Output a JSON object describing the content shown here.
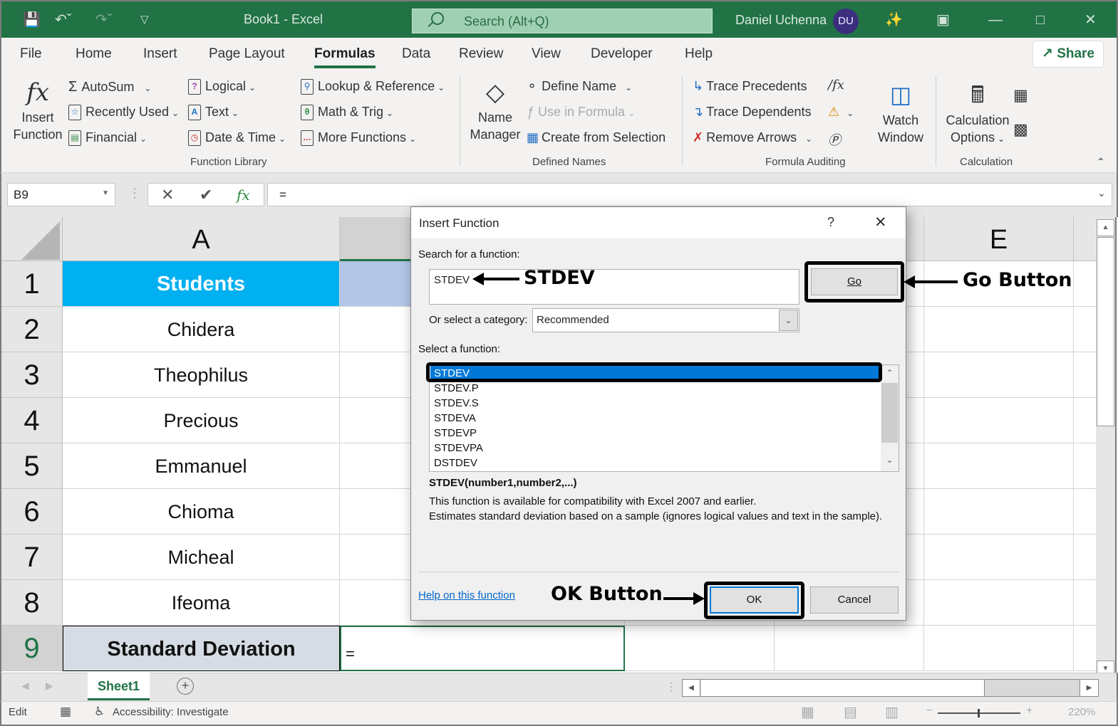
{
  "titlebar": {
    "title": "Book1  -  Excel",
    "search_placeholder": "Search (Alt+Q)",
    "user_name": "Daniel Uchenna",
    "user_initials": "DU"
  },
  "ribbon_tabs": [
    {
      "label": "File"
    },
    {
      "label": "Home"
    },
    {
      "label": "Insert"
    },
    {
      "label": "Page Layout"
    },
    {
      "label": "Formulas",
      "active": true
    },
    {
      "label": "Data"
    },
    {
      "label": "Review"
    },
    {
      "label": "View"
    },
    {
      "label": "Developer"
    },
    {
      "label": "Help"
    }
  ],
  "share_label": "Share",
  "ribbon": {
    "function_library": {
      "group_label": "Function Library",
      "insert_function": [
        "Insert",
        "Function"
      ],
      "autosum": "AutoSum",
      "recently_used": "Recently Used",
      "financial": "Financial",
      "logical": "Logical",
      "text": "Text",
      "date_time": "Date & Time",
      "lookup_reference": "Lookup & Reference",
      "math_trig": "Math & Trig",
      "more_functions": "More Functions"
    },
    "defined_names": {
      "group_label": "Defined Names",
      "name_manager": [
        "Name",
        "Manager"
      ],
      "define_name": "Define Name",
      "use_in_formula": "Use in Formula",
      "create_from_selection": "Create from Selection"
    },
    "formula_auditing": {
      "group_label": "Formula Auditing",
      "trace_precedents": "Trace Precedents",
      "trace_dependents": "Trace Dependents",
      "remove_arrows": "Remove Arrows",
      "watch_window": [
        "Watch",
        "Window"
      ]
    },
    "calculation": {
      "group_label": "Calculation",
      "calculation_options": [
        "Calculation",
        "Options"
      ]
    }
  },
  "formula_bar": {
    "name_box": "B9",
    "formula": "="
  },
  "sheet": {
    "columns": [
      "A",
      "E"
    ],
    "rows": [
      "1",
      "2",
      "3",
      "4",
      "5",
      "6",
      "7",
      "8",
      "9"
    ],
    "header_cell": "Students",
    "students": [
      "Chidera",
      "Theophilus",
      "Precious",
      "Emmanuel",
      "Chioma",
      "Micheal",
      "Ifeoma"
    ],
    "row9_label": "Standard Deviation",
    "active_cell_value": "=",
    "colors": {
      "header_bg": "#00b0f0",
      "row9_bg": "#d6dce4",
      "b1_bg": "#b4c6e7"
    }
  },
  "sheet_tabs": [
    {
      "label": "Sheet1",
      "active": true
    }
  ],
  "statusbar": {
    "mode": "Edit",
    "accessibility": "Accessibility: Investigate",
    "zoom": "220%"
  },
  "dialog": {
    "title": "Insert Function",
    "help_glyph": "?",
    "search_label": "Search for a function:",
    "search_value": "STDEV",
    "go_label": "Go",
    "category_label": "Or select a category:",
    "category_value": "Recommended",
    "select_label": "Select a function:",
    "functions": [
      "STDEV",
      "STDEV.P",
      "STDEV.S",
      "STDEVA",
      "STDEVP",
      "STDEVPA",
      "DSTDEV"
    ],
    "selected_index": 0,
    "signature": "STDEV(number1,number2,...)",
    "description_1": "This function is available for compatibility with Excel 2007 and earlier.",
    "description_2": "Estimates standard deviation based on a sample (ignores logical values and text in the sample).",
    "help_link": "Help on this function",
    "ok_label": "OK",
    "cancel_label": "Cancel"
  },
  "annotations": {
    "search_note": "STDEV",
    "go_note": "Go Button",
    "ok_note": "OK Button"
  }
}
